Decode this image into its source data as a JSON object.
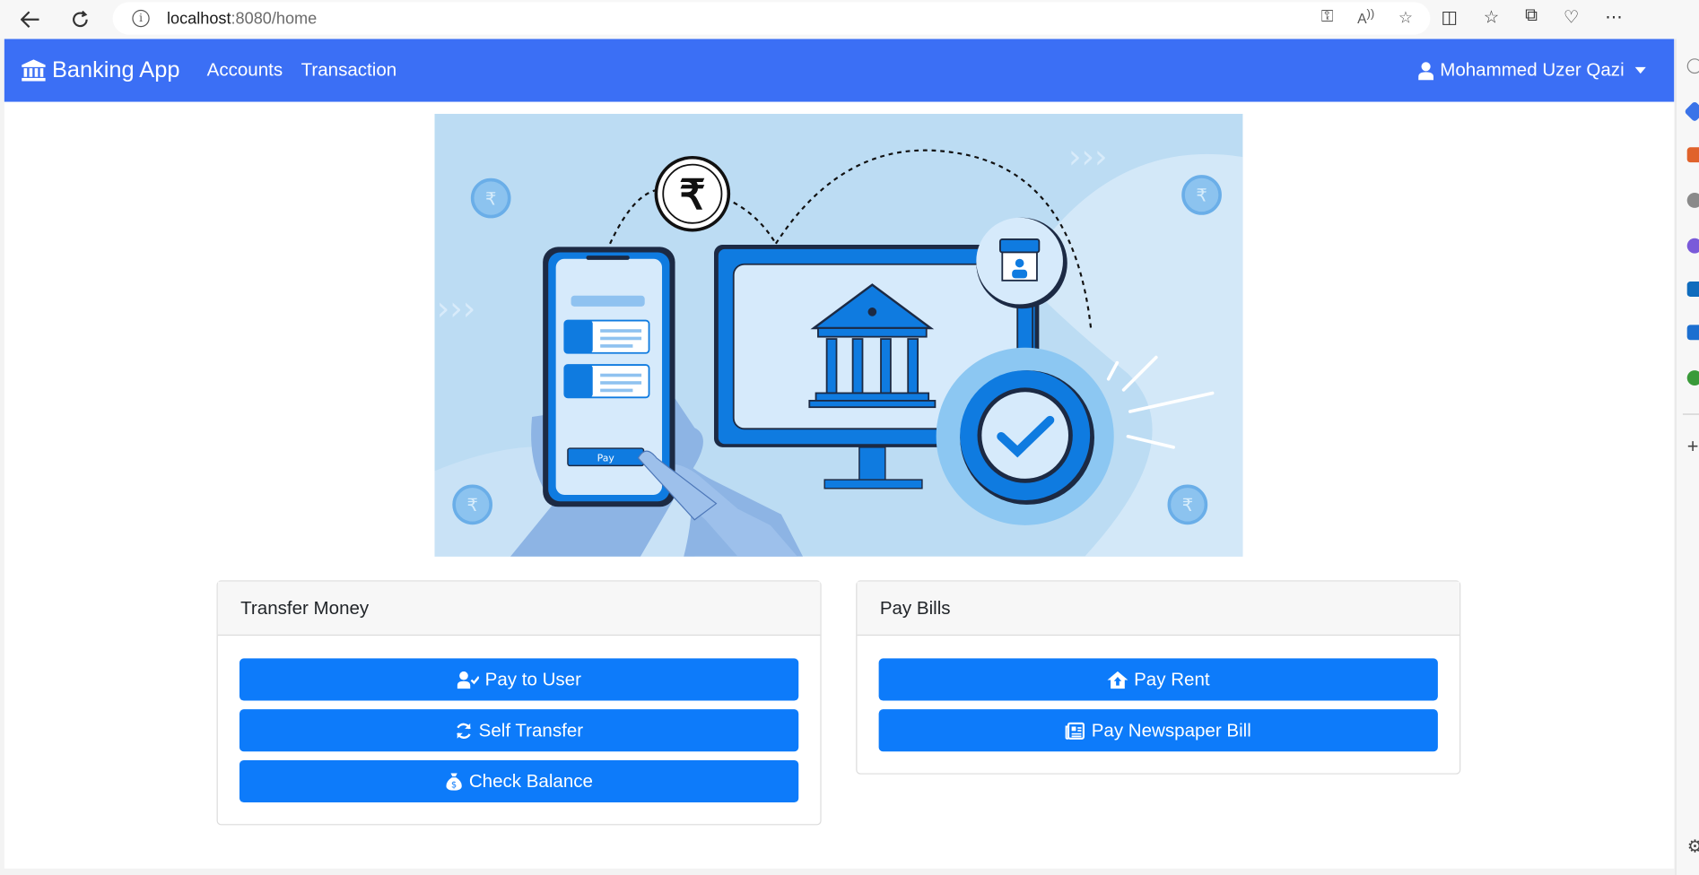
{
  "browser": {
    "url_host": "localhost",
    "url_rest": ":8080/home"
  },
  "navbar": {
    "brand": "Banking App",
    "links": [
      "Accounts",
      "Transaction"
    ],
    "user_name": "Mohammed Uzer Qazi",
    "color": "#3b6ff5"
  },
  "hero": {
    "pay_label": "Pay",
    "currency_symbol": "₹"
  },
  "transfer_card": {
    "title": "Transfer Money",
    "buttons": [
      "Pay to User",
      "Self Transfer",
      "Check Balance"
    ]
  },
  "bills_card": {
    "title": "Pay Bills",
    "buttons": [
      "Pay Rent",
      "Pay Newspaper Bill"
    ]
  },
  "colors": {
    "button": "#0d7bfa",
    "hero_bg": "#bcdcf3"
  }
}
